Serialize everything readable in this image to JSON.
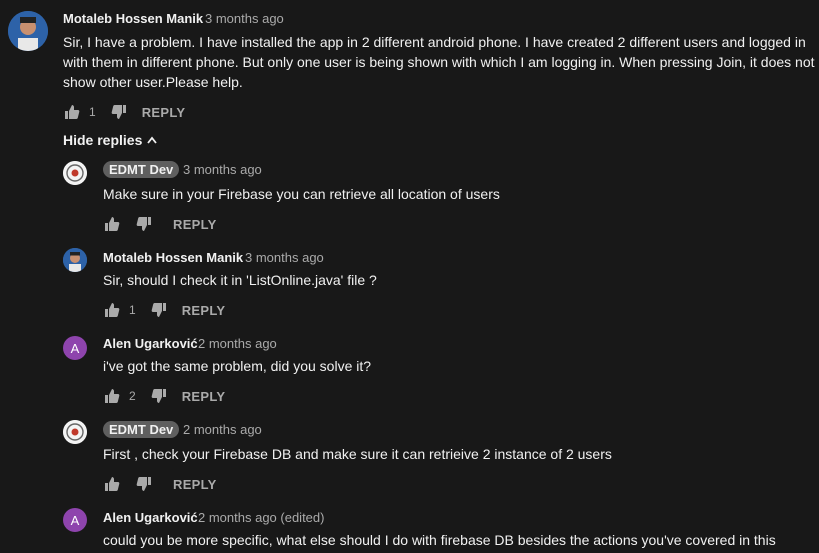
{
  "comments": [
    {
      "author": "Motaleb Hossen Manik",
      "time": "3 months ago",
      "text": "Sir, I have a problem. I have installed the app in 2 different android phone. I have created 2 different users and logged in with them in different phone. But only one user is being shown with which I am logging in. When pressing Join, it does not show other user.Please help.",
      "likes": "1",
      "reply_label": "REPLY"
    }
  ],
  "hide_replies_label": "Hide replies",
  "replies": [
    {
      "author": "EDMT Dev",
      "time": "3 months ago",
      "text": "Make sure in your Firebase you can retrieve all location of users",
      "likes": "",
      "reply_label": "REPLY"
    },
    {
      "author": "Motaleb Hossen Manik",
      "time": "3 months ago",
      "text": "Sir, should I check it in 'ListOnline.java' file ?",
      "likes": "1",
      "reply_label": "REPLY"
    },
    {
      "author": "Alen Ugarković",
      "avatar_letter": "A",
      "time": "2 months ago",
      "text": "i've got the same problem, did you solve it?",
      "likes": "2",
      "reply_label": "REPLY"
    },
    {
      "author": "EDMT Dev",
      "time": "2 months ago",
      "text": "First , check your Firebase DB and make sure it can retrieive 2 instance of 2 users",
      "likes": "",
      "reply_label": "REPLY"
    },
    {
      "author": "Alen Ugarković",
      "avatar_letter": "A",
      "time": "2 months ago (edited)",
      "text": "could you be more specific, what else should I do with firebase DB besides the actions you've covered in this"
    }
  ]
}
